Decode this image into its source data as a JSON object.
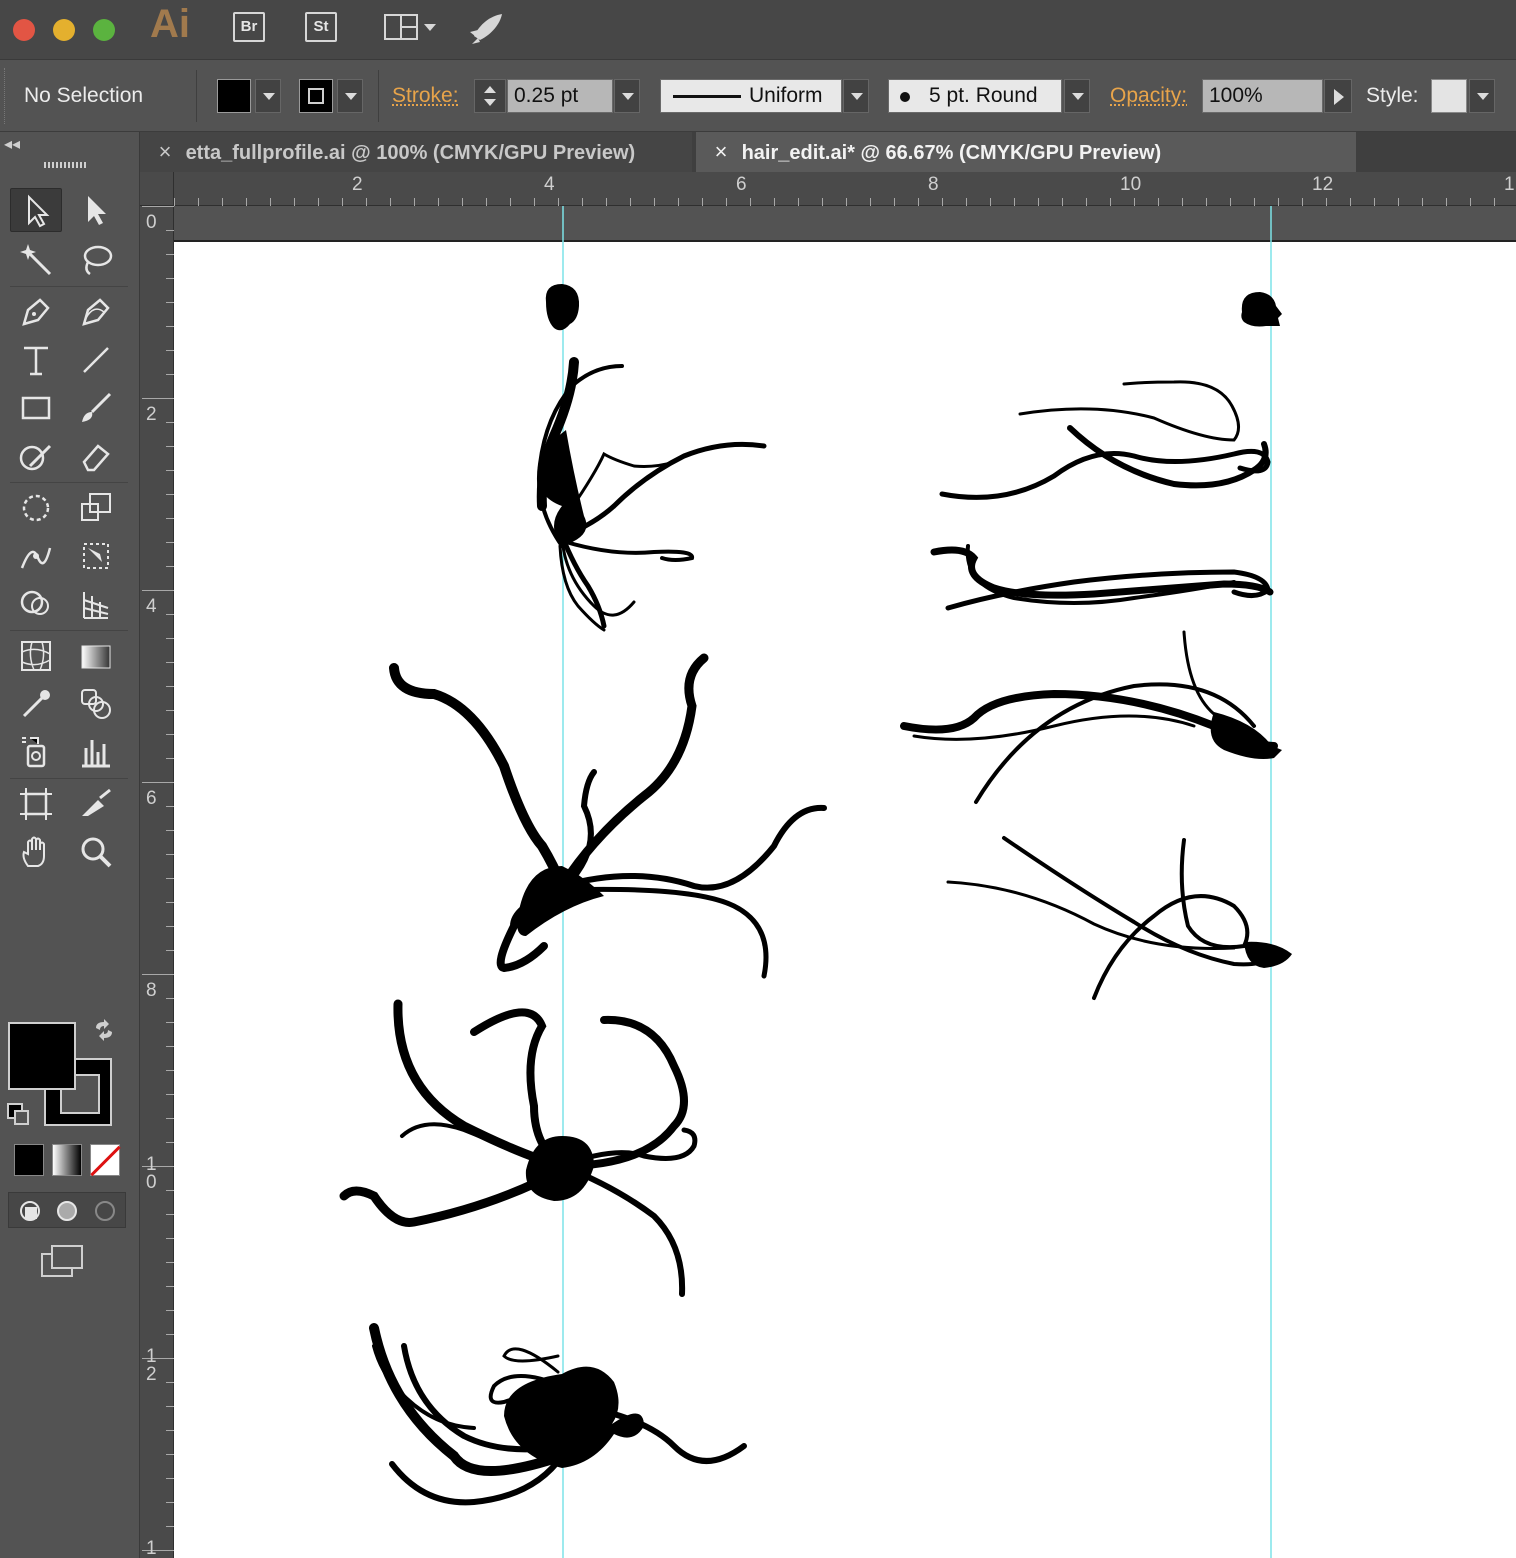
{
  "app": {
    "logo": "Ai",
    "bridge": "Br",
    "stock": "St"
  },
  "control": {
    "selection": "No Selection",
    "stroke_label": "Stroke:",
    "stroke_weight": "0.25 pt",
    "profile": "Uniform",
    "brush": "5 pt. Round",
    "opacity_label": "Opacity:",
    "opacity_value": "100%",
    "style_label": "Style:"
  },
  "tabs": [
    {
      "label": "etta_fullprofile.ai @ 100% (CMYK/GPU Preview)",
      "active": false
    },
    {
      "label": "hair_edit.ai* @ 66.67% (CMYK/GPU Preview)",
      "active": true
    }
  ],
  "ruler_h": [
    "2",
    "4",
    "6",
    "8",
    "10",
    "12",
    "1"
  ],
  "ruler_v": [
    "0",
    "2",
    "4",
    "6",
    "8",
    "1\n0",
    "1\n2",
    "1"
  ],
  "colors": {
    "guide": "#7de3e8",
    "accent_label": "#e8a44a",
    "fill": "#000000",
    "stroke": "#000000"
  }
}
